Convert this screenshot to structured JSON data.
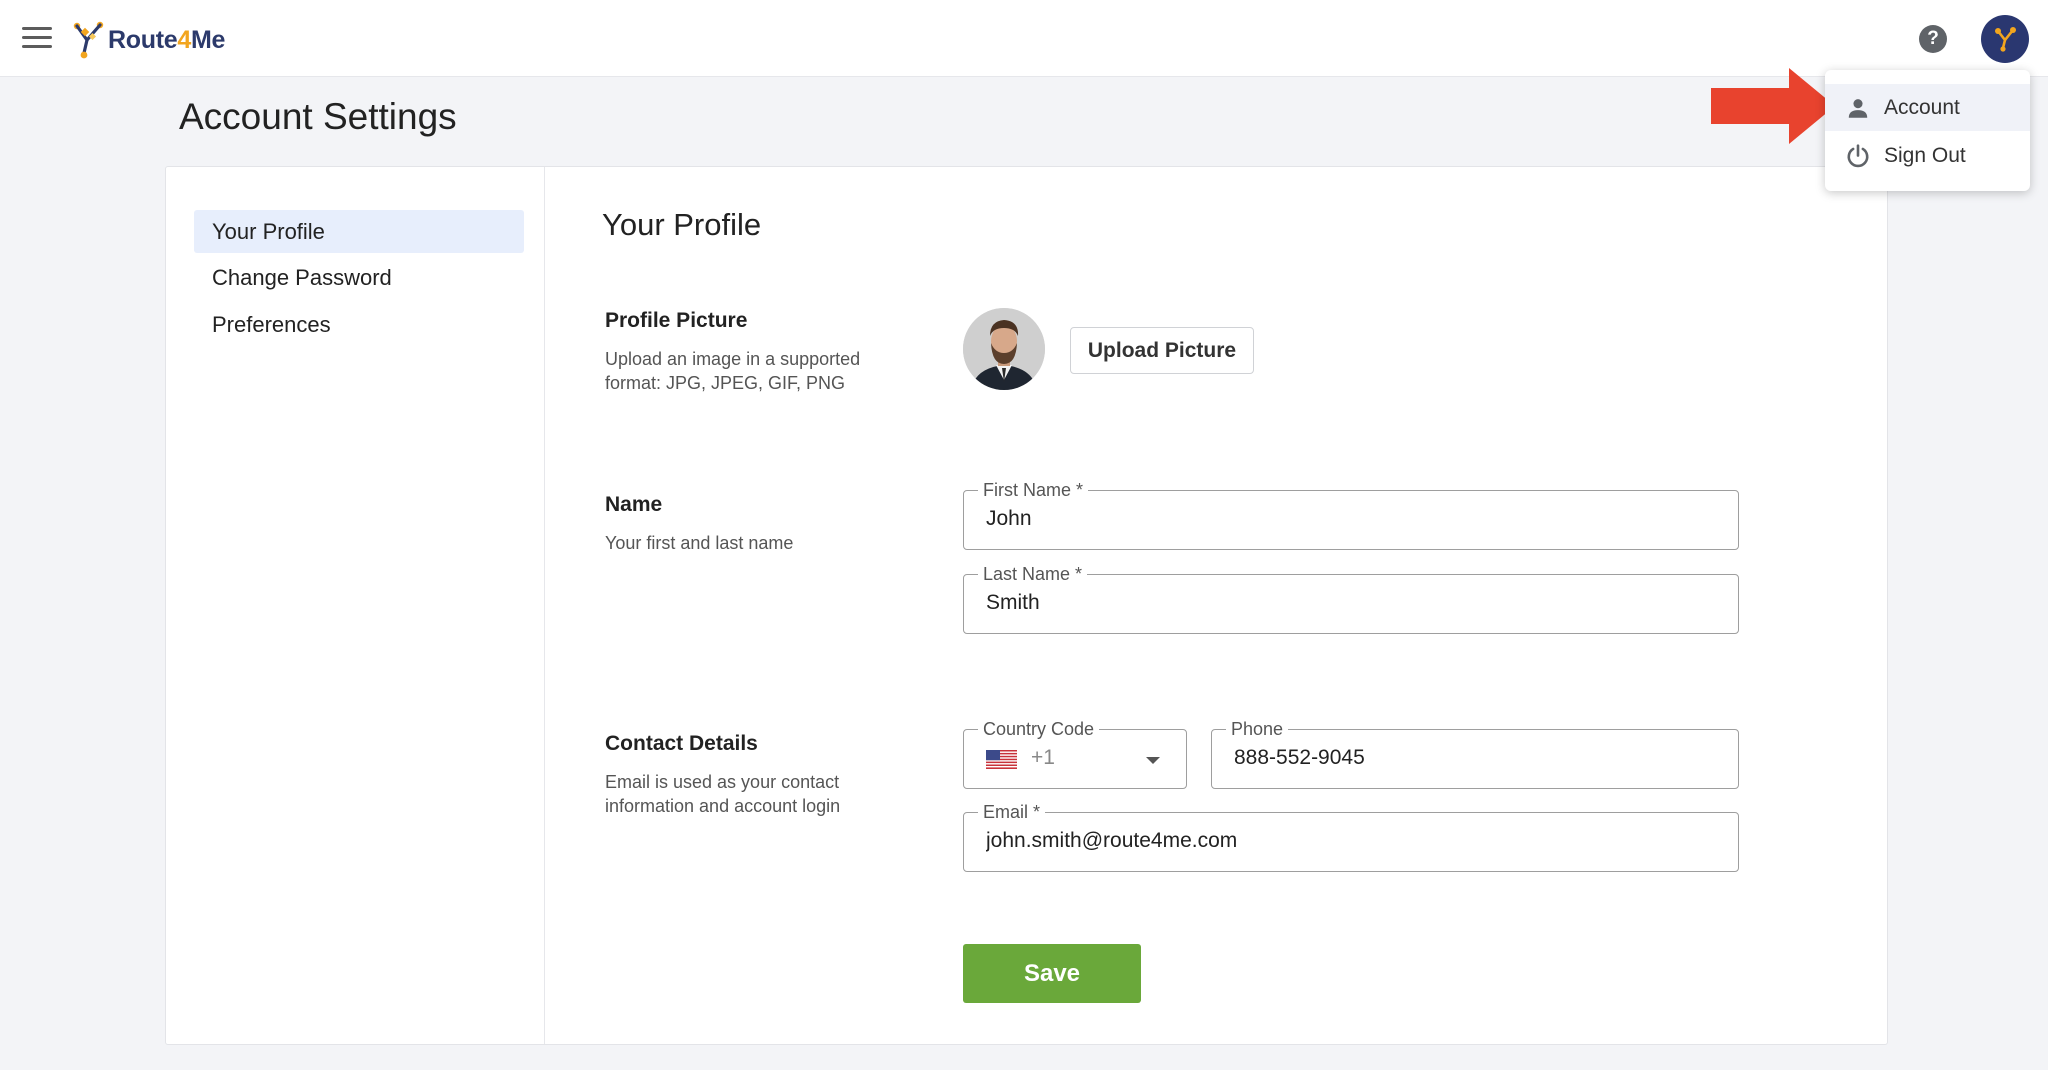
{
  "header": {
    "logo_text_a": "Route",
    "logo_text_b": "4",
    "logo_text_c": "Me",
    "help_icon": "question-circle-icon",
    "avatar_icon": "user-avatar-icon"
  },
  "page": {
    "title": "Account Settings"
  },
  "sidebar": {
    "items": [
      {
        "label": "Your Profile",
        "active": true
      },
      {
        "label": "Change Password",
        "active": false
      },
      {
        "label": "Preferences",
        "active": false
      }
    ]
  },
  "main": {
    "title": "Your Profile",
    "profile_picture": {
      "title": "Profile Picture",
      "description": "Upload an image in a supported format: JPG, JPEG, GIF, PNG",
      "upload_label": "Upload Picture"
    },
    "name": {
      "title": "Name",
      "description": "Your first and last name",
      "first_name_label": "First Name *",
      "first_name_value": "John",
      "last_name_label": "Last Name *",
      "last_name_value": "Smith"
    },
    "contact": {
      "title": "Contact Details",
      "description": "Email is used as your contact information and account login",
      "country_code_label": "Country Code",
      "country_code_value": "+1",
      "phone_label": "Phone",
      "phone_value": "888-552-9045",
      "email_label": "Email *",
      "email_value": "john.smith@route4me.com"
    },
    "save_label": "Save"
  },
  "menu": {
    "items": [
      {
        "label": "Account",
        "icon": "person-icon"
      },
      {
        "label": "Sign Out",
        "icon": "power-icon"
      }
    ]
  },
  "colors": {
    "accent_green": "#6aa83a",
    "brand_navy": "#2c3a6b",
    "brand_orange": "#f2a51e",
    "active_nav_bg": "#e7eefc",
    "annotation_red": "#e8432e"
  }
}
